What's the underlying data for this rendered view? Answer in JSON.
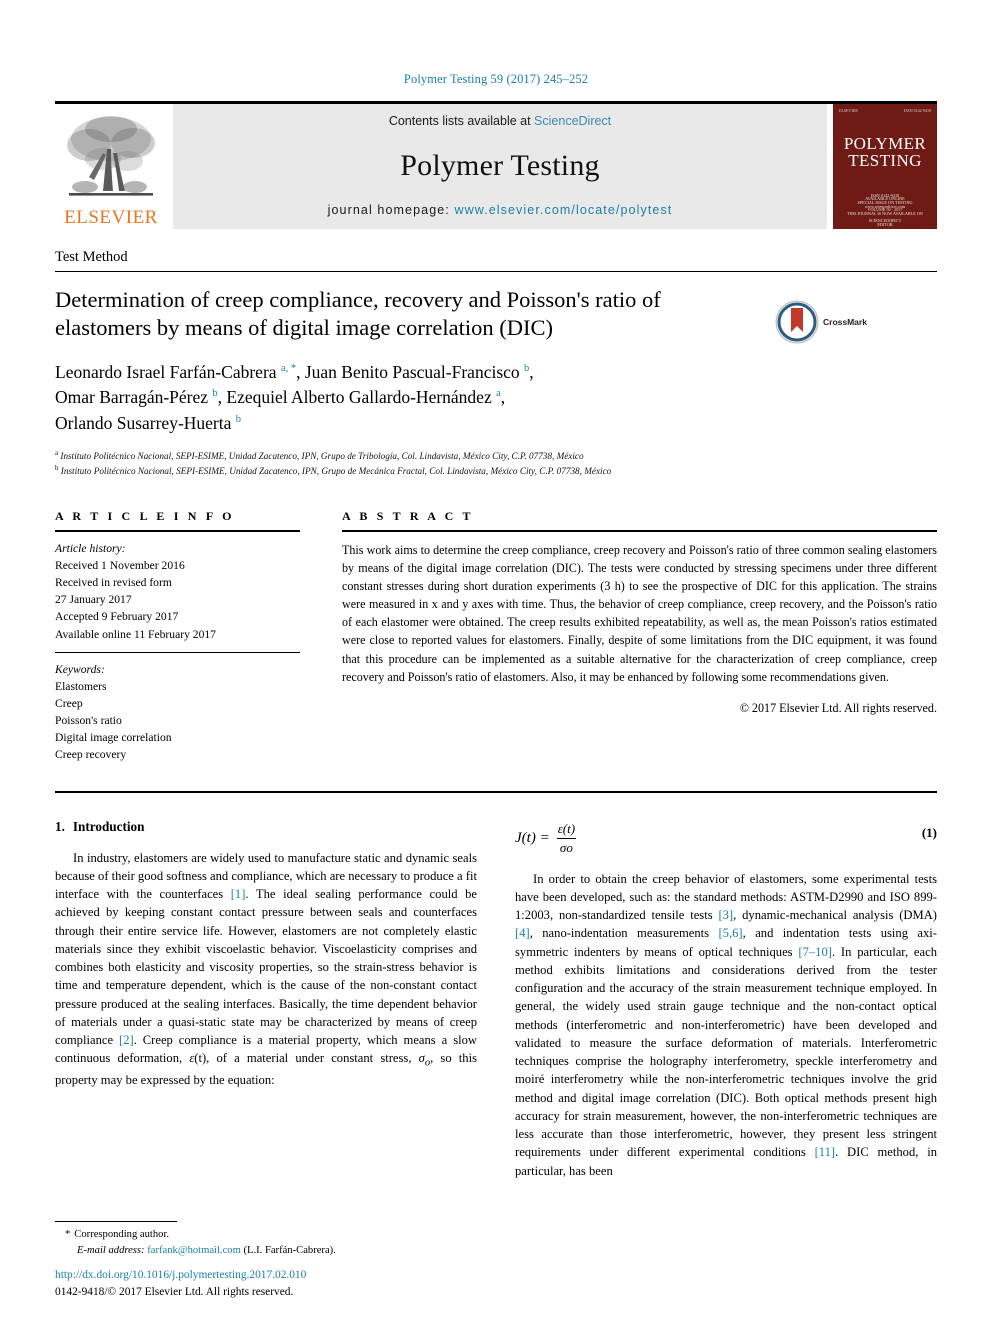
{
  "running_head": "Polymer Testing 59 (2017) 245–252",
  "masthead": {
    "contents_prefix": "Contents lists available at ",
    "sciencedirect": "ScienceDirect",
    "journal_title": "Polymer Testing",
    "homepage_prefix": "journal homepage: ",
    "homepage_url": "www.elsevier.com/locate/polytest",
    "elsevier_wordmark": "ELSEVIER",
    "cover": {
      "title_line1": "POLYMER",
      "title_line2": "TESTING",
      "sub_block": "ISSN 0142-9418\nSPECIAL ISSUE ON TESTING\nVOLUME 59 · 2017\n\nEDITOR\nPROFESSOR ROGER BROWN\nRapra Technology, Shawbury, Shrewsbury",
      "foot_block": "AVAILABLE ONLINE\nwww.sciencedirect.com\nTHIS JOURNAL IS NOW AVAILABLE ON\nSCIENCEDIRECT"
    }
  },
  "article": {
    "section_type": "Test Method",
    "title": "Determination of creep compliance, recovery and Poisson's ratio of elastomers by means of digital image correlation (DIC)",
    "crossmark_label": "CrossMark",
    "authors_html": "Leonardo Israel Farfán-Cabrera <sup>a, *</sup>, Juan Benito Pascual-Francisco <sup>b</sup>,<br>Omar Barragán-Pérez <sup>b</sup>, Ezequiel Alberto Gallardo-Hernández <sup>a</sup>,<br>Orlando Susarrey-Huerta <sup>b</sup>",
    "affiliation_a": "Instituto Politécnico Nacional, SEPI-ESIME, Unidad Zacatenco, IPN, Grupo de Tribología, Col. Lindavista, México City, C.P. 07738, México",
    "affiliation_b": "Instituto Politécnico Nacional, SEPI-ESIME, Unidad Zacatenco, IPN, Grupo de Mecánica Fractal, Col. Lindavista, México City, C.P. 07738, México",
    "affiliation_a_marker": "a",
    "affiliation_b_marker": "b"
  },
  "article_info": {
    "header": "A R T I C L E   I N F O",
    "history_label": "Article history:",
    "history": [
      "Received 1 November 2016",
      "Received in revised form",
      "27 January 2017",
      "Accepted 9 February 2017",
      "Available online 11 February 2017"
    ],
    "keywords_label": "Keywords:",
    "keywords": [
      "Elastomers",
      "Creep",
      "Poisson's ratio",
      "Digital image correlation",
      "Creep recovery"
    ]
  },
  "abstract": {
    "header": "A B S T R A C T",
    "text": "This work aims to determine the creep compliance, creep recovery and Poisson's ratio of three common sealing elastomers by means of the digital image correlation (DIC). The tests were conducted by stressing specimens under three different constant stresses during short duration experiments (3 h) to see the prospective of DIC for this application. The strains were measured in x and y axes with time. Thus, the behavior of creep compliance, creep recovery, and the Poisson's ratio of each elastomer were obtained. The creep results exhibited repeatability, as well as, the mean Poisson's ratios estimated were close to reported values for elastomers. Finally, despite of some limitations from the DIC equipment, it was found that this procedure can be implemented as a suitable alternative for the characterization of creep compliance, creep recovery and Poisson's ratio of elastomers. Also, it may be enhanced by following some recommendations given.",
    "copyright": "© 2017 Elsevier Ltd. All rights reserved."
  },
  "introduction": {
    "number": "1.",
    "title": "Introduction",
    "para1_html": "In industry, elastomers are widely used to manufacture static and dynamic seals because of their good softness and compliance, which are necessary to produce a fit interface with the counterfaces <span class=\"ref\">[1]</span>. The ideal sealing performance could be achieved by keeping constant contact pressure between seals and counterfaces through their entire service life. However, elastomers are not completely elastic materials since they exhibit viscoelastic behavior. Viscoelasticity comprises and combines both elasticity and viscosity properties, so the strain-stress behavior is time and temperature dependent, which is the cause of the non-constant contact pressure produced at the sealing interfaces. Basically, the time dependent behavior of materials under a quasi-static state may be characterized by means of creep compliance <span class=\"ref\">[2]</span>. Creep compliance is a material property, which means a slow continuous deformation, <i>ε</i>(t), of a material under constant stress, <i>σ<sub>o</sub></i>, so this property may be expressed by the equation:",
    "equation": {
      "lhs": "J(t) =",
      "numerator": "ε(t)",
      "denominator": "σo",
      "number": "(1)"
    },
    "para2_html": "In order to obtain the creep behavior of elastomers, some experimental tests have been developed, such as: the standard methods: ASTM-D2990 and ISO 899-1:2003, non-standardized tensile tests <span class=\"ref\">[3]</span>, dynamic-mechanical analysis (DMA) <span class=\"ref\">[4]</span>, nano-indentation measurements <span class=\"ref\">[5,6]</span>, and indentation tests using axi-symmetric indenters by means of optical techniques <span class=\"ref\">[7–10]</span>. In particular, each method exhibits limitations and considerations derived from the tester configuration and the accuracy of the strain measurement technique employed. In general, the widely used strain gauge technique and the non-contact optical methods (interferometric and non-interferometric) have been developed and validated to measure the surface deformation of materials. Interferometric techniques comprise the holography interferometry, speckle interferometry and moiré interferometry while the non-interferometric techniques involve the grid method and digital image correlation (DIC). Both optical methods present high accuracy for strain measurement, however, the non-interferometric techniques are less accurate than those interferometric, however, they present less stringent requirements under different experimental conditions <span class=\"ref\">[11]</span>. DIC method, in particular, has been"
  },
  "footer": {
    "corresponding_star": "*",
    "corresponding_text": "Corresponding author.",
    "email_label": "E-mail address:",
    "email": "farfank@hotmail.com",
    "email_owner": "(L.I. Farfán-Cabrera).",
    "doi": "http://dx.doi.org/10.1016/j.polymertesting.2017.02.010",
    "issn": "0142-9418/© 2017 Elsevier Ltd. All rights reserved."
  },
  "colors": {
    "link": "#1b7fa8",
    "elsevier_orange": "#E87722",
    "cover_maroon": "#6e1b16",
    "masthead_grey": "#e9e9e9"
  }
}
